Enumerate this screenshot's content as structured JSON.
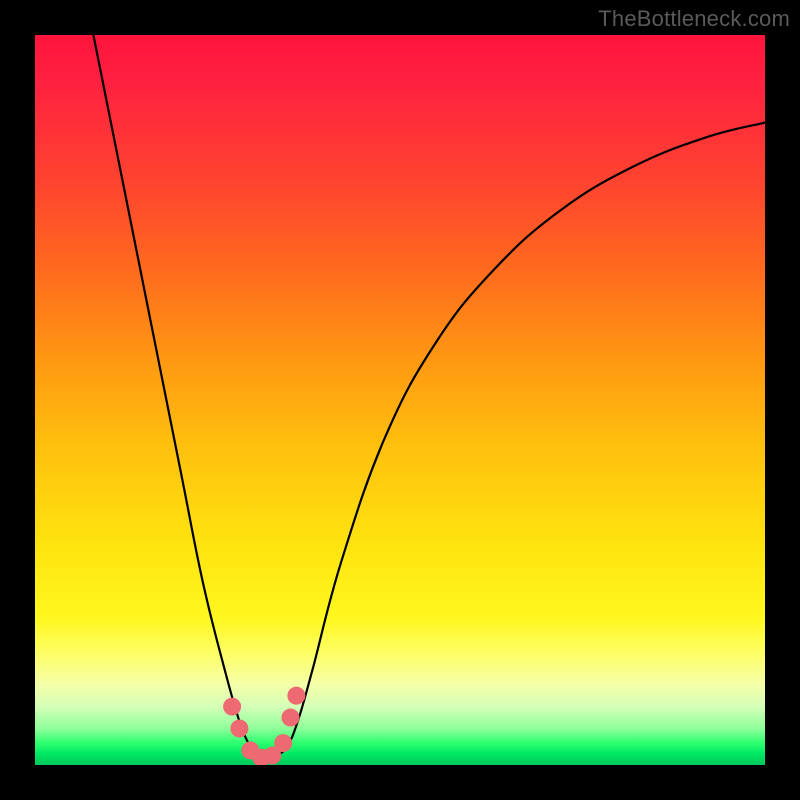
{
  "watermark": "TheBottleneck.com",
  "colors": {
    "frame": "#000000",
    "curve": "#000000",
    "dots": "#ee6a72"
  },
  "chart_data": {
    "type": "line",
    "title": "",
    "xlabel": "",
    "ylabel": "",
    "xlim": [
      0,
      100
    ],
    "ylim": [
      0,
      100
    ],
    "grid": false,
    "legend": false,
    "note": "Values are estimated from pixel positions; axes unlabeled. y=0 bottom, y=100 top.",
    "series": [
      {
        "name": "bottleneck-curve",
        "x": [
          8,
          12,
          16,
          20,
          23,
          26,
          28,
          29.5,
          30.5,
          31.5,
          33,
          34.5,
          36,
          38,
          42,
          48,
          55,
          63,
          72,
          82,
          92,
          100
        ],
        "y": [
          100,
          80,
          60,
          40,
          25,
          13,
          6,
          2.5,
          1.3,
          1.0,
          1.3,
          2.5,
          6,
          13,
          28,
          45,
          58,
          68,
          76,
          82,
          86,
          88
        ]
      }
    ],
    "markers": [
      {
        "x": 27.0,
        "y": 8.0
      },
      {
        "x": 28.0,
        "y": 5.0
      },
      {
        "x": 29.5,
        "y": 2.0
      },
      {
        "x": 31.0,
        "y": 1.0
      },
      {
        "x": 32.5,
        "y": 1.3
      },
      {
        "x": 34.0,
        "y": 3.0
      },
      {
        "x": 35.0,
        "y": 6.5
      },
      {
        "x": 35.8,
        "y": 9.5
      }
    ]
  }
}
